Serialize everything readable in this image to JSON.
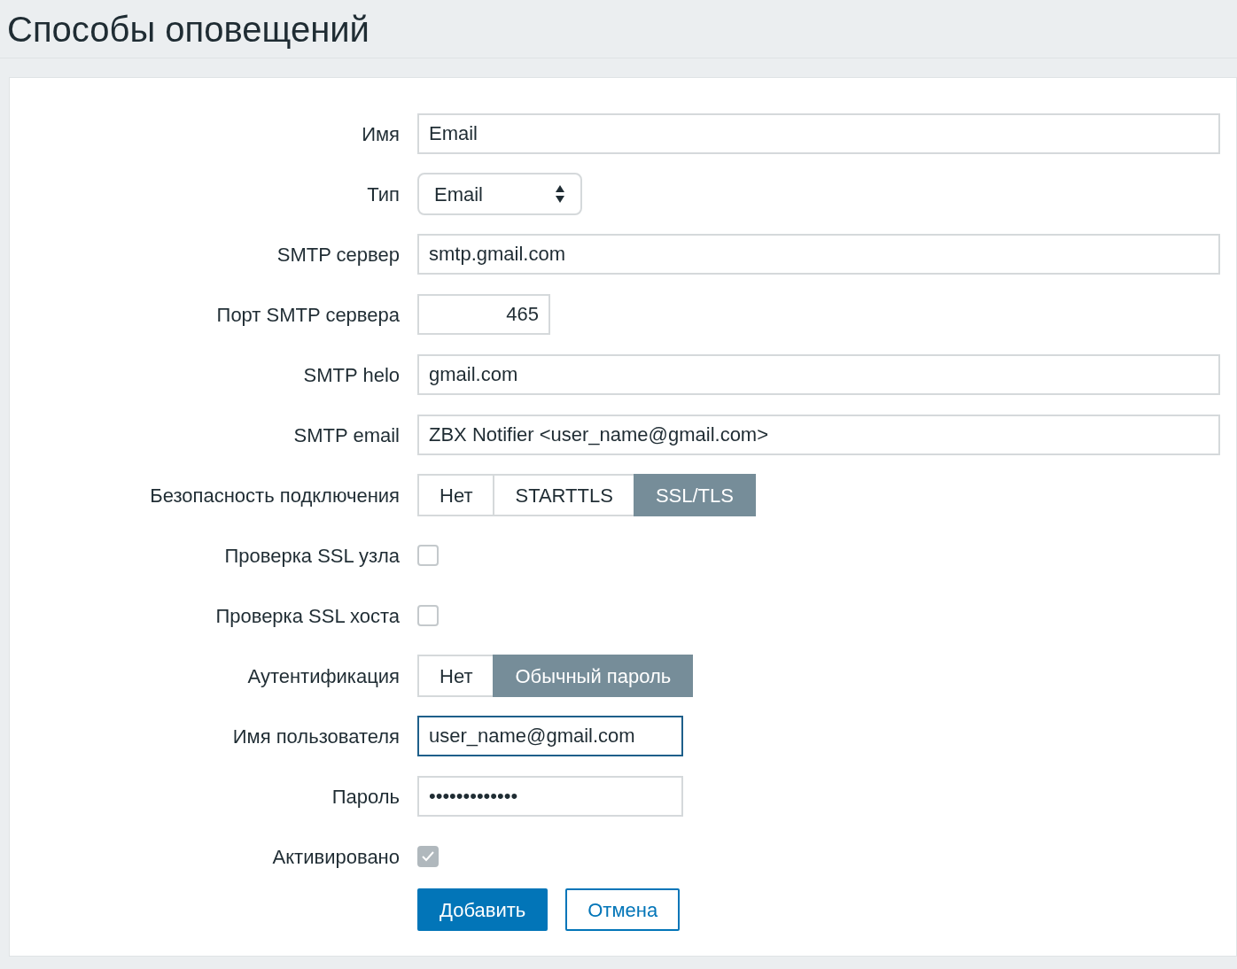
{
  "title": "Способы оповещений",
  "rows": [
    {
      "label": "Имя",
      "kind": "text",
      "value": "Email",
      "focused": false
    },
    {
      "label": "Тип",
      "kind": "select",
      "value": "Email"
    },
    {
      "label": "SMTP сервер",
      "kind": "text",
      "value": "smtp.gmail.com",
      "focused": false
    },
    {
      "label": "Порт SMTP сервера",
      "kind": "number",
      "value": "465"
    },
    {
      "label": "SMTP helo",
      "kind": "text",
      "value": "gmail.com",
      "focused": false
    },
    {
      "label": "SMTP email",
      "kind": "text",
      "value": "ZBX Notifier <user_name@gmail.com>",
      "focused": false
    },
    {
      "label": "Безопасность подключения",
      "kind": "segmented",
      "options": [
        {
          "label": "Нет",
          "selected": false
        },
        {
          "label": "STARTTLS",
          "selected": false
        },
        {
          "label": "SSL/TLS",
          "selected": true
        }
      ]
    },
    {
      "label": "Проверка SSL узла",
      "kind": "checkbox",
      "checked": false
    },
    {
      "label": "Проверка SSL хоста",
      "kind": "checkbox",
      "checked": false
    },
    {
      "label": "Аутентификация",
      "kind": "segmented",
      "options": [
        {
          "label": "Нет",
          "selected": false
        },
        {
          "label": "Обычный пароль",
          "selected": true
        }
      ]
    },
    {
      "label": "Имя пользователя",
      "kind": "short_text",
      "value": "user_name@gmail.com",
      "focused": true
    },
    {
      "label": "Пароль",
      "kind": "short_text",
      "value": "•••••••••••••",
      "focused": false
    },
    {
      "label": "Активировано",
      "kind": "checkbox",
      "checked": true
    }
  ],
  "buttons": [
    {
      "label": "Добавить",
      "kind": "primary"
    },
    {
      "label": "Отмена",
      "kind": "secondary"
    }
  ]
}
